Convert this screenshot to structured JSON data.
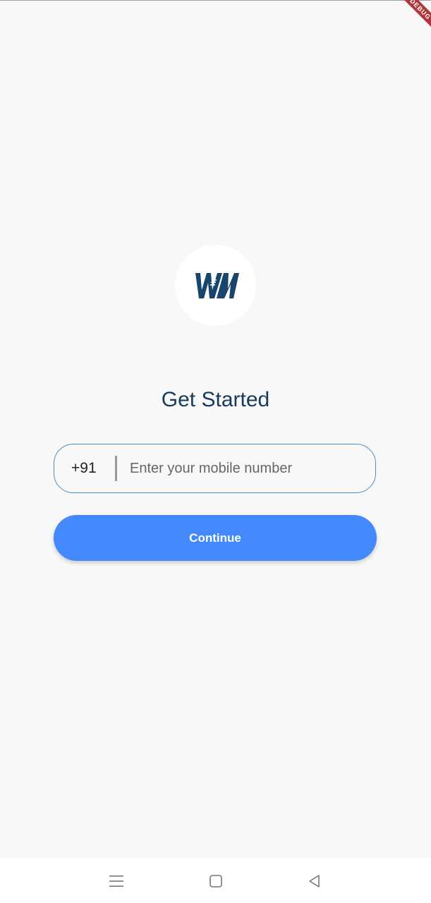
{
  "debug_banner": {
    "label": "DEBUG"
  },
  "logo": {
    "text": "WM",
    "color": "#17456e"
  },
  "page": {
    "title": "Get Started"
  },
  "phone": {
    "country_code": "+91",
    "placeholder": "Enter your mobile number",
    "value": ""
  },
  "actions": {
    "continue_label": "Continue"
  },
  "colors": {
    "accent": "#4489fc",
    "field_border": "#4a90c8",
    "title": "#1a3a5c"
  },
  "navigation": {
    "icons": [
      "menu-icon",
      "home-square-icon",
      "back-triangle-icon"
    ]
  }
}
